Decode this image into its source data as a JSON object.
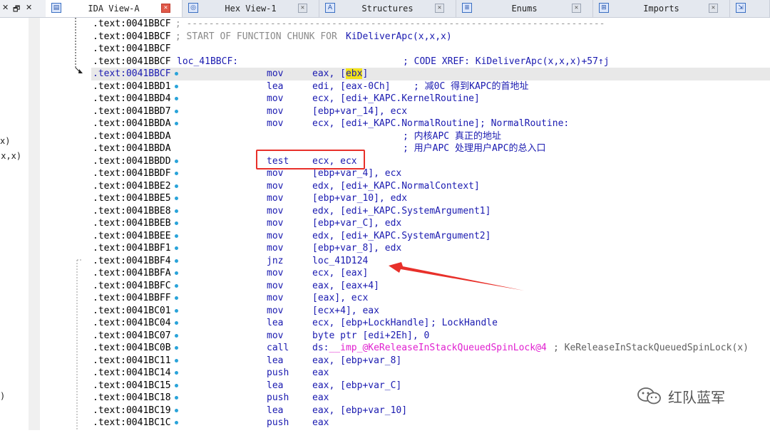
{
  "left_controls": {
    "close": "✕",
    "restore": "🗗",
    "close2": "✕"
  },
  "tabs": [
    {
      "label": "IDA View-A",
      "icon": "ida-view-icon",
      "glyph": "▤",
      "active": true
    },
    {
      "label": "Hex View-1",
      "icon": "hex-view-icon",
      "glyph": "◎",
      "active": false
    },
    {
      "label": "Structures",
      "icon": "structures-icon",
      "glyph": "A",
      "active": false
    },
    {
      "label": "Enums",
      "icon": "enums-icon",
      "glyph": "≣",
      "active": false
    },
    {
      "label": "Imports",
      "icon": "imports-icon",
      "glyph": "⊞",
      "active": false
    },
    {
      "label": "",
      "icon": "exports-icon",
      "glyph": "⇲",
      "active": false
    }
  ],
  "left_pane_fragments": [
    "x)",
    "(x,x)",
    ")"
  ],
  "listing": [
    {
      "addr": ".text:0041BBCF",
      "kind": "sep",
      "text": " ; ---------------------------------------------------------------------------"
    },
    {
      "addr": ".text:0041BBCF",
      "kind": "chunk",
      "text": " ; START OF FUNCTION CHUNK FOR ",
      "func": "KiDeliverApc(x,x,x)"
    },
    {
      "addr": ".text:0041BBCF",
      "kind": "blank"
    },
    {
      "addr": ".text:0041BBCF",
      "kind": "label",
      "label": "loc_41BBCF:",
      "xref": "; CODE XREF: KiDeliverApc(x,x,x)+57↑j"
    },
    {
      "addr": ".text:0041BBCF",
      "kind": "ins",
      "mn": "mov",
      "op_pre": "eax, [",
      "op_reg": "ebx",
      "op_post": "]",
      "hl": true
    },
    {
      "addr": ".text:0041BBD1",
      "kind": "ins",
      "mn": "lea",
      "op": "edi, [eax-0Ch]",
      "cm": "; 减0C 得到KAPC的首地址"
    },
    {
      "addr": ".text:0041BBD4",
      "kind": "ins",
      "mn": "mov",
      "op": "ecx, [edi+_KAPC.KernelRoutine]"
    },
    {
      "addr": ".text:0041BBD7",
      "kind": "ins",
      "mn": "mov",
      "op": "[ebp+var_14], ecx"
    },
    {
      "addr": ".text:0041BBDA",
      "kind": "ins",
      "mn": "mov",
      "op": "ecx, [edi+_KAPC.NormalRoutine]",
      "cm": "; NormalRoutine:"
    },
    {
      "addr": ".text:0041BBDA",
      "kind": "comment",
      "cm": "; 内核APC 真正的地址"
    },
    {
      "addr": ".text:0041BBDA",
      "kind": "comment",
      "cm": "; 用户APC 处理用户APC的总入口"
    },
    {
      "addr": ".text:0041BBDD",
      "kind": "ins",
      "mn": "test",
      "op": "ecx, ecx"
    },
    {
      "addr": ".text:0041BBDF",
      "kind": "ins",
      "mn": "mov",
      "op": "[ebp+var_4], ecx"
    },
    {
      "addr": ".text:0041BBE2",
      "kind": "ins",
      "mn": "mov",
      "op": "edx, [edi+_KAPC.NormalContext]"
    },
    {
      "addr": ".text:0041BBE5",
      "kind": "ins",
      "mn": "mov",
      "op": "[ebp+var_10], edx"
    },
    {
      "addr": ".text:0041BBE8",
      "kind": "ins",
      "mn": "mov",
      "op": "edx, [edi+_KAPC.SystemArgument1]"
    },
    {
      "addr": ".text:0041BBEB",
      "kind": "ins",
      "mn": "mov",
      "op": "[ebp+var_C], edx"
    },
    {
      "addr": ".text:0041BBEE",
      "kind": "ins",
      "mn": "mov",
      "op": "edx, [edi+_KAPC.SystemArgument2]"
    },
    {
      "addr": ".text:0041BBF1",
      "kind": "ins",
      "mn": "mov",
      "op": "[ebp+var_8], edx"
    },
    {
      "addr": ".text:0041BBF4",
      "kind": "ins",
      "mn": "jnz",
      "op": "loc_41D124"
    },
    {
      "addr": ".text:0041BBFA",
      "kind": "ins",
      "mn": "mov",
      "op": "ecx, [eax]"
    },
    {
      "addr": ".text:0041BBFC",
      "kind": "ins",
      "mn": "mov",
      "op": "eax, [eax+4]"
    },
    {
      "addr": ".text:0041BBFF",
      "kind": "ins",
      "mn": "mov",
      "op": "[eax], ecx"
    },
    {
      "addr": ".text:0041BC01",
      "kind": "ins",
      "mn": "mov",
      "op": "[ecx+4], eax"
    },
    {
      "addr": ".text:0041BC04",
      "kind": "ins",
      "mn": "lea",
      "op": "ecx, [ebp+LockHandle]",
      "cm": "; LockHandle"
    },
    {
      "addr": ".text:0041BC07",
      "kind": "ins",
      "mn": "mov",
      "op": "byte ptr [edi+2Eh], 0"
    },
    {
      "addr": ".text:0041BC0B",
      "kind": "call",
      "mn": "call",
      "op_pre": "ds:",
      "op_imp": "__imp_@KeReleaseInStackQueuedSpinLock@4",
      "cm": "; KeReleaseInStackQueuedSpinLock(x)"
    },
    {
      "addr": ".text:0041BC11",
      "kind": "ins",
      "mn": "lea",
      "op": "eax, [ebp+var_8]"
    },
    {
      "addr": ".text:0041BC14",
      "kind": "ins",
      "mn": "push",
      "op": "eax"
    },
    {
      "addr": ".text:0041BC15",
      "kind": "ins",
      "mn": "lea",
      "op": "eax, [ebp+var_C]"
    },
    {
      "addr": ".text:0041BC18",
      "kind": "ins",
      "mn": "push",
      "op": "eax"
    },
    {
      "addr": ".text:0041BC19",
      "kind": "ins",
      "mn": "lea",
      "op": "eax, [ebp+var_10]"
    },
    {
      "addr": ".text:0041BC1C",
      "kind": "ins",
      "mn": "push",
      "op": "eax"
    }
  ],
  "watermark": {
    "text": "红队蓝军",
    "icon": "wechat-icon"
  },
  "colors": {
    "annotation_red": "#e8302a",
    "highlight_yellow": "#f2e21a",
    "code_blue": "#1a1ab0",
    "import_pink": "#e020d0"
  }
}
